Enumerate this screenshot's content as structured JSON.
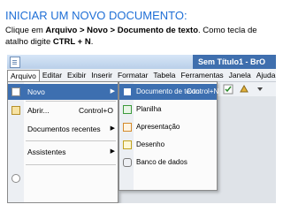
{
  "slide": {
    "title": "INICIAR UM NOVO DOCUMENTO:",
    "instr_prefix": "Clique em ",
    "instr_path": "Arquivo > Novo > Documento de texto",
    "instr_middle": ". Como tecla de atalho digite ",
    "instr_shortcut": "CTRL + N",
    "instr_end": "."
  },
  "window": {
    "title": "Sem Título1 - BrO"
  },
  "menubar": {
    "items": [
      "Arquivo",
      "Editar",
      "Exibir",
      "Inserir",
      "Formatar",
      "Tabela",
      "Ferramentas",
      "Janela",
      "Ajuda"
    ]
  },
  "arquivo_menu": {
    "novo": "Novo",
    "abrir": "Abrir...",
    "abrir_shortcut": "Control+O",
    "recentes": "Documentos recentes",
    "assistentes": "Assistentes"
  },
  "novo_submenu": {
    "documento_texto": "Documento de texto",
    "documento_texto_shortcut": "Control+N",
    "planilha": "Planilha",
    "apresentacao": "Apresentação",
    "desenho": "Desenho",
    "banco_dados": "Banco de dados"
  },
  "colors": {
    "title_blue": "#1f6fd6",
    "highlight": "#3d6fb0"
  }
}
